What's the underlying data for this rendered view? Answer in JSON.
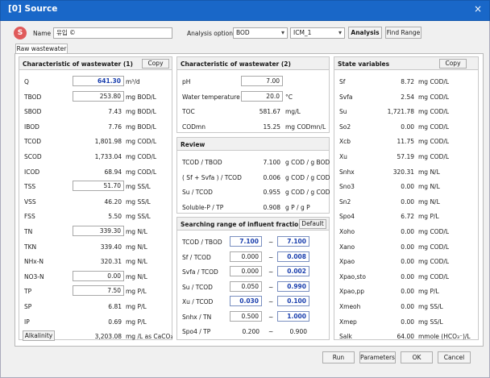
{
  "window": {
    "title": "[0] Source",
    "close": "×"
  },
  "header": {
    "avatar": "S",
    "name_label": "Name",
    "name_value": "유입 ©",
    "analysis_option_label": "Analysis option",
    "option1": "BOD",
    "option2": "ICM_1",
    "analysis_btn": "Analysis",
    "find_range_btn": "Find Range"
  },
  "tab": "Raw wastewater",
  "g1": {
    "title": "Characteristic of wastewater (1)",
    "copy": "Copy",
    "rows": [
      {
        "label": "Q",
        "value": "641.30",
        "unit": "m³/d",
        "input": true,
        "blue": true
      },
      {
        "label": "TBOD",
        "value": "253.80",
        "unit": "mg BOD/L",
        "input": true
      },
      {
        "label": "SBOD",
        "value": "7.43",
        "unit": "mg BOD/L"
      },
      {
        "label": "IBOD",
        "value": "7.76",
        "unit": "mg BOD/L"
      },
      {
        "label": "TCOD",
        "value": "1,801.98",
        "unit": "mg COD/L"
      },
      {
        "label": "SCOD",
        "value": "1,733.04",
        "unit": "mg COD/L"
      },
      {
        "label": "ICOD",
        "value": "68.94",
        "unit": "mg COD/L"
      },
      {
        "label": "TSS",
        "value": "51.70",
        "unit": "mg SS/L",
        "input": true
      },
      {
        "label": "VSS",
        "value": "46.20",
        "unit": "mg SS/L"
      },
      {
        "label": "FSS",
        "value": "5.50",
        "unit": "mg SS/L"
      },
      {
        "label": "TN",
        "value": "339.30",
        "unit": "mg N/L",
        "input": true
      },
      {
        "label": "TKN",
        "value": "339.40",
        "unit": "mg N/L"
      },
      {
        "label": "NHx-N",
        "value": "320.31",
        "unit": "mg N/L"
      },
      {
        "label": "NO3-N",
        "value": "0.00",
        "unit": "mg N/L",
        "input": true
      },
      {
        "label": "TP",
        "value": "7.50",
        "unit": "mg P/L",
        "input": true
      },
      {
        "label": "SP",
        "value": "6.81",
        "unit": "mg P/L"
      },
      {
        "label": "IP",
        "value": "0.69",
        "unit": "mg P/L"
      },
      {
        "label": "Alkalinity",
        "value": "3,203.08",
        "unit": "mg /L as CaCO₃",
        "button": true
      }
    ]
  },
  "g2": {
    "title": "Characteristic of wastewater (2)",
    "rows": [
      {
        "label": "pH",
        "value": "7.00",
        "unit": "",
        "input": true
      },
      {
        "label": "Water temperature",
        "value": "20.0",
        "unit": "°C",
        "input": true
      },
      {
        "label": "TOC",
        "value": "581.67",
        "unit": "mg/L"
      },
      {
        "label": "CODmn",
        "value": "15.25",
        "unit": "mg CODmn/L"
      }
    ]
  },
  "review": {
    "title": "Review",
    "rows": [
      {
        "label": "TCOD / TBOD",
        "value": "7.100",
        "unit": "g COD / g BOD"
      },
      {
        "label": "( Sf + Svfa ) / TCOD",
        "value": "0.006",
        "unit": "g COD / g COD"
      },
      {
        "label": "Su / TCOD",
        "value": "0.955",
        "unit": "g COD / g COD"
      },
      {
        "label": "Soluble-P / TP",
        "value": "0.908",
        "unit": "g P / g P"
      }
    ]
  },
  "search": {
    "title": "Searching range of influent fraction",
    "default_btn": "Default",
    "tilde": "~",
    "rows": [
      {
        "label": "TCOD / TBOD",
        "min": "7.100",
        "max": "7.100",
        "minBlue": true,
        "maxBlue": true
      },
      {
        "label": "Sf / TCOD",
        "min": "0.000",
        "max": "0.008",
        "maxBlue": true
      },
      {
        "label": "Svfa / TCOD",
        "min": "0.000",
        "max": "0.002",
        "maxBlue": true
      },
      {
        "label": "Su / TCOD",
        "min": "0.050",
        "max": "0.990",
        "maxBlue": true
      },
      {
        "label": "Xu / TCOD",
        "min": "0.030",
        "max": "0.100",
        "minBlue": true,
        "maxBlue": true
      },
      {
        "label": "Snhx / TN",
        "min": "0.500",
        "max": "1.000",
        "maxBlue": true
      },
      {
        "label": "Spo4 / TP",
        "min": "0.200",
        "max": "0.900",
        "plain": true
      }
    ]
  },
  "state": {
    "title": "State variables",
    "copy": "Copy",
    "rows": [
      {
        "label": "Sf",
        "value": "8.72",
        "unit": "mg COD/L"
      },
      {
        "label": "Svfa",
        "value": "2.54",
        "unit": "mg COD/L"
      },
      {
        "label": "Su",
        "value": "1,721.78",
        "unit": "mg COD/L"
      },
      {
        "label": "So2",
        "value": "0.00",
        "unit": "mg COD/L"
      },
      {
        "label": "Xcb",
        "value": "11.75",
        "unit": "mg COD/L"
      },
      {
        "label": "Xu",
        "value": "57.19",
        "unit": "mg COD/L"
      },
      {
        "label": "Snhx",
        "value": "320.31",
        "unit": "mg N/L"
      },
      {
        "label": "Sno3",
        "value": "0.00",
        "unit": "mg N/L"
      },
      {
        "label": "Sn2",
        "value": "0.00",
        "unit": "mg N/L"
      },
      {
        "label": "Spo4",
        "value": "6.72",
        "unit": "mg P/L"
      },
      {
        "label": "Xoho",
        "value": "0.00",
        "unit": "mg COD/L"
      },
      {
        "label": "Xano",
        "value": "0.00",
        "unit": "mg COD/L"
      },
      {
        "label": "Xpao",
        "value": "0.00",
        "unit": "mg COD/L"
      },
      {
        "label": "Xpao,sto",
        "value": "0.00",
        "unit": "mg COD/L"
      },
      {
        "label": "Xpao,pp",
        "value": "0.00",
        "unit": "mg P/L"
      },
      {
        "label": "Xmeoh",
        "value": "0.00",
        "unit": "mg SS/L"
      },
      {
        "label": "Xmep",
        "value": "0.00",
        "unit": "mg SS/L"
      },
      {
        "label": "Salk",
        "value": "64.00",
        "unit": "mmole (HCO₃⁻)/L"
      }
    ]
  },
  "footer": {
    "run": "Run",
    "parameters": "Parameters",
    "ok": "OK",
    "cancel": "Cancel"
  }
}
